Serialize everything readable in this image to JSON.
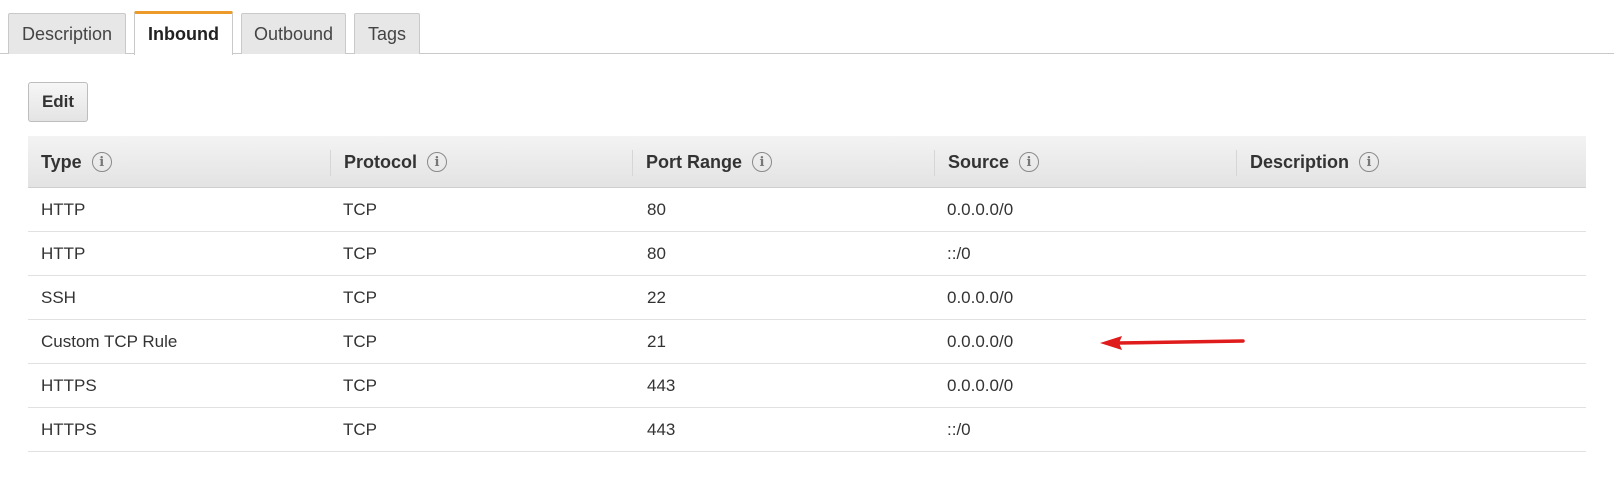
{
  "tabs": [
    {
      "label": "Description",
      "active": false
    },
    {
      "label": "Inbound",
      "active": true
    },
    {
      "label": "Outbound",
      "active": false
    },
    {
      "label": "Tags",
      "active": false
    }
  ],
  "toolbar": {
    "edit_label": "Edit"
  },
  "table": {
    "columns": [
      "Type",
      "Protocol",
      "Port Range",
      "Source",
      "Description"
    ],
    "info_icon_glyph": "i",
    "rows": [
      {
        "type": "HTTP",
        "protocol": "TCP",
        "port_range": "80",
        "source": "0.0.0.0/0",
        "description": ""
      },
      {
        "type": "HTTP",
        "protocol": "TCP",
        "port_range": "80",
        "source": "::/0",
        "description": ""
      },
      {
        "type": "SSH",
        "protocol": "TCP",
        "port_range": "22",
        "source": "0.0.0.0/0",
        "description": ""
      },
      {
        "type": "Custom TCP Rule",
        "protocol": "TCP",
        "port_range": "21",
        "source": "0.0.0.0/0",
        "description": ""
      },
      {
        "type": "HTTPS",
        "protocol": "TCP",
        "port_range": "443",
        "source": "0.0.0.0/0",
        "description": ""
      },
      {
        "type": "HTTPS",
        "protocol": "TCP",
        "port_range": "443",
        "source": "::/0",
        "description": ""
      }
    ]
  },
  "annotation": {
    "icon": "arrow-left-icon",
    "color": "#e01b1b"
  },
  "colors": {
    "active_tab_accent": "#ec9a29"
  }
}
